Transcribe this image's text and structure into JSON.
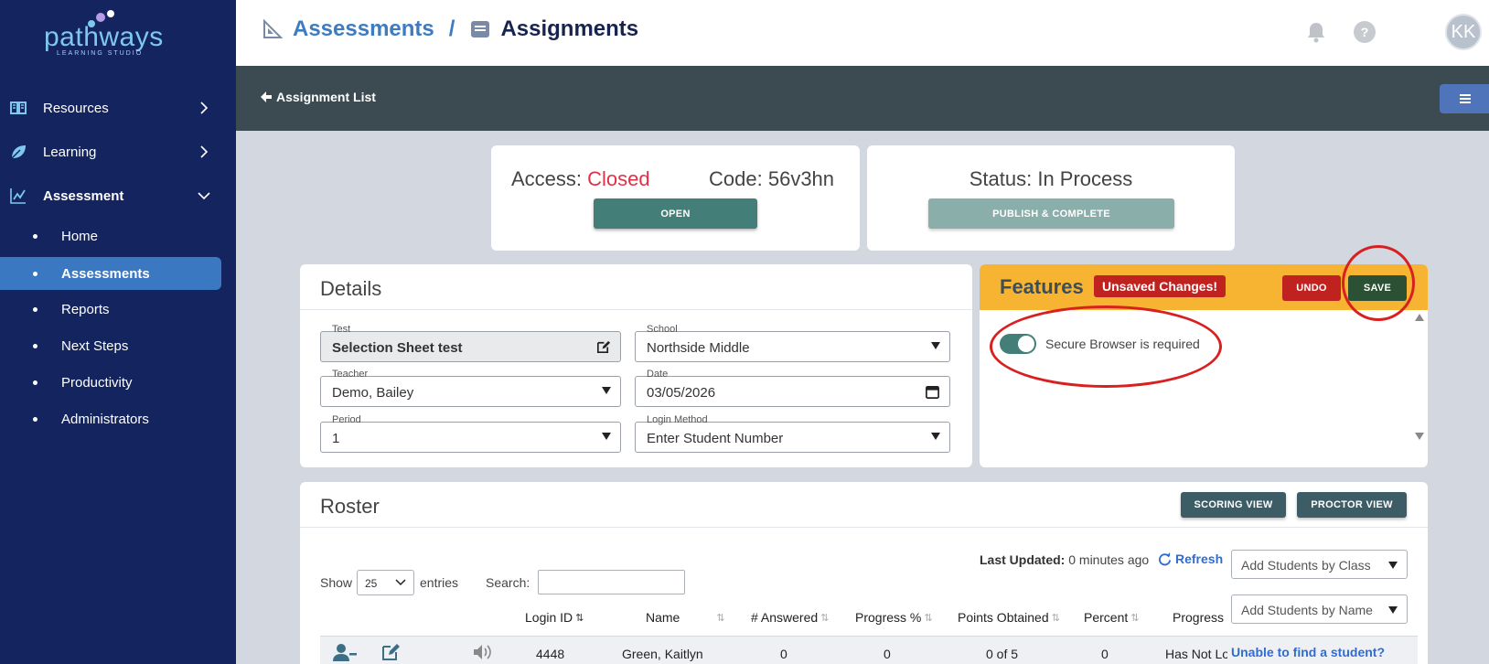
{
  "sidebar": {
    "logo_word": "pathways",
    "logo_sub": "LEARNING STUDIO",
    "top_items": [
      {
        "label": "Resources"
      },
      {
        "label": "Learning"
      },
      {
        "label": "Assessment"
      }
    ],
    "sub_items": [
      {
        "label": "Home"
      },
      {
        "label": "Assessments"
      },
      {
        "label": "Reports"
      },
      {
        "label": "Next Steps"
      },
      {
        "label": "Productivity"
      },
      {
        "label": "Administrators"
      }
    ]
  },
  "header": {
    "crumb_parent": "Assessments",
    "crumb_sep": "/",
    "crumb_current": "Assignments",
    "avatar_initials": "KK"
  },
  "toolbar": {
    "back_label": "Assignment List"
  },
  "access": {
    "label": "Access:",
    "state": "Closed",
    "code_label": "Code:",
    "code": "56v3hn",
    "open_button": "OPEN",
    "state_color": "#e0314a"
  },
  "status": {
    "text": "Status: In Process",
    "publish_button": "PUBLISH & COMPLETE"
  },
  "details": {
    "title": "Details",
    "test": {
      "label": "Test",
      "value": "Selection Sheet test"
    },
    "school": {
      "label": "School",
      "value": "Northside Middle"
    },
    "teacher": {
      "label": "Teacher",
      "value": "Demo, Bailey"
    },
    "date": {
      "label": "Date",
      "value": "03/05/2026"
    },
    "period": {
      "label": "Period",
      "value": "1"
    },
    "login_method": {
      "label": "Login Method",
      "value": "Enter Student Number"
    }
  },
  "features": {
    "title": "Features",
    "badge": "Unsaved Changes!",
    "undo": "UNDO",
    "save": "SAVE",
    "secure_browser_label": "Secure Browser is required",
    "secure_browser_on": true
  },
  "roster": {
    "title": "Roster",
    "scoring_view": "SCORING VIEW",
    "proctor_view": "PROCTOR VIEW",
    "last_updated_label": "Last Updated:",
    "last_updated_value": "0 minutes ago",
    "refresh": "Refresh",
    "add_by_class": "Add Students by Class",
    "add_by_name": "Add Students by Name",
    "show": "Show",
    "entries_value": "25",
    "entries": "entries",
    "search_label": "Search:",
    "columns": [
      "Login ID",
      "Name",
      "# Answered",
      "Progress %",
      "Points Obtained",
      "Percent",
      "Progress"
    ],
    "rows": [
      {
        "login_id": "4448",
        "name": "Green, Kaitlyn",
        "answered": "0",
        "progress_pct": "0",
        "points": "0 of 5",
        "percent": "0",
        "progress": "Has Not Lo"
      }
    ],
    "unable": "Unable to find a student?"
  }
}
